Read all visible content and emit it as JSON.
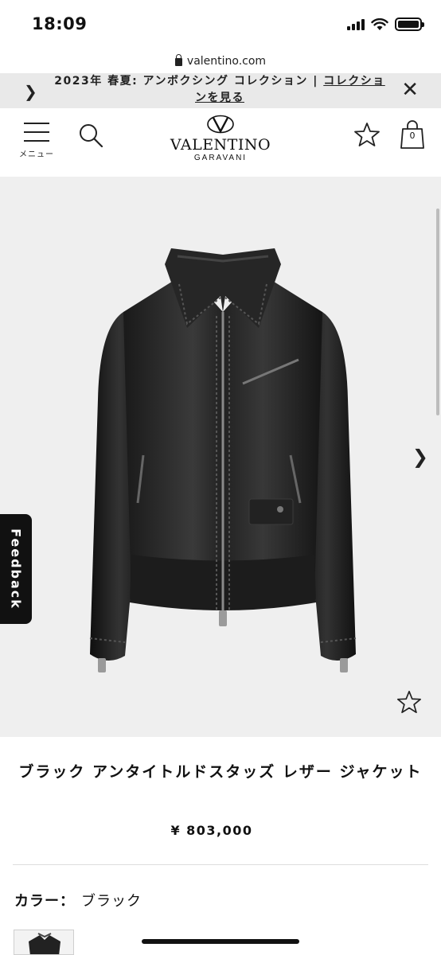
{
  "status_bar": {
    "time": "18:09"
  },
  "browser": {
    "url": "valentino.com"
  },
  "promo": {
    "text": "2023年 春夏: アンボクシング コレクション | ",
    "link_text": "コレクションを見る"
  },
  "header": {
    "menu_label": "メニュー",
    "logo_main": "VALENTINO",
    "logo_sub": "GARAVANI",
    "cart_count": "0"
  },
  "feedback_label": "Feedback",
  "product": {
    "title": "ブラック アンタイトルドスタッズ レザー ジャケット",
    "price": "¥ 803,000",
    "color_label": "カラー：",
    "color_value": "ブラック"
  },
  "colors": {
    "accent": "#111111",
    "banner_bg": "#e9e9e9",
    "gallery_bg": "#efefef"
  }
}
